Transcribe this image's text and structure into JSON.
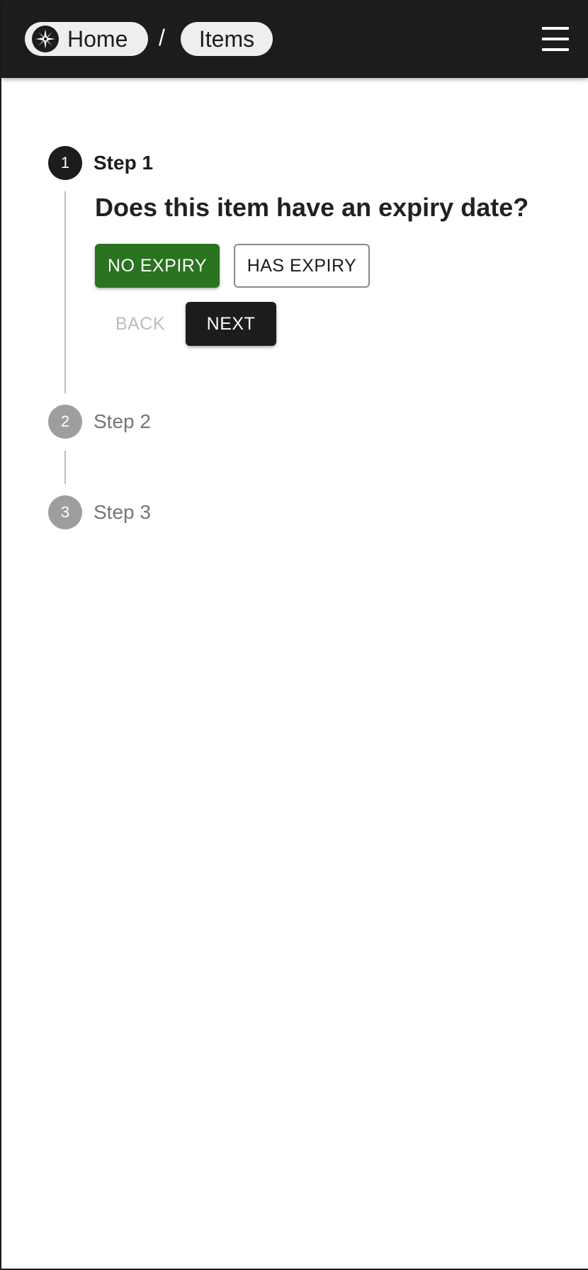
{
  "header": {
    "breadcrumbs": [
      {
        "label": "Home",
        "icon": "compass-rose-icon"
      },
      {
        "label": "Items"
      }
    ],
    "separator": "/",
    "menu_icon": "hamburger-menu-icon"
  },
  "stepper": {
    "steps": [
      {
        "number": "1",
        "label": "Step 1",
        "state": "active"
      },
      {
        "number": "2",
        "label": "Step 2",
        "state": "inactive"
      },
      {
        "number": "3",
        "label": "Step 3",
        "state": "inactive"
      }
    ],
    "question": "Does this item have an expiry date?",
    "options": [
      {
        "label": "NO EXPIRY",
        "selected": true
      },
      {
        "label": "HAS EXPIRY",
        "selected": false
      }
    ],
    "back_label": "BACK",
    "next_label": "NEXT"
  },
  "colors": {
    "appbar": "#1c1c1c",
    "selected_option": "#2a7320",
    "active_step": "#1c1c1c",
    "inactive_step": "#9e9e9e"
  }
}
